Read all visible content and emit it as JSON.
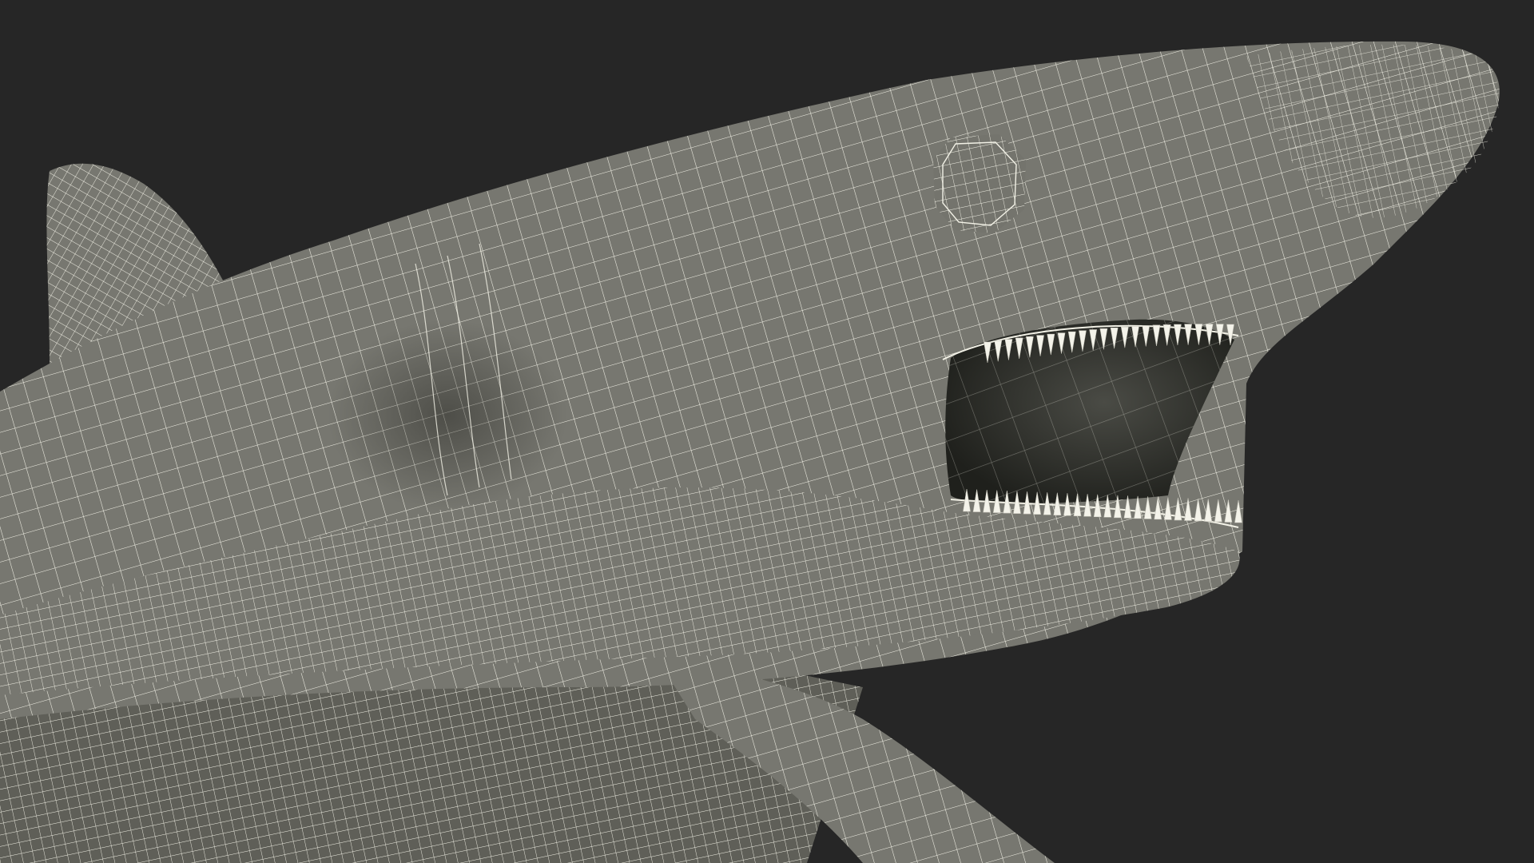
{
  "scene": {
    "subject": "shark-wireframe-render",
    "background_color": "#262626",
    "surface_color": "#777770",
    "surface_shade_color": "#5f5f58",
    "surface_highlight_color": "#8a8a83",
    "wire_color": "#f2f1e6",
    "mouth_interior_color": "#2c2d29",
    "tooth_color": "#f4f3ea",
    "eye_color": "#74746d"
  }
}
